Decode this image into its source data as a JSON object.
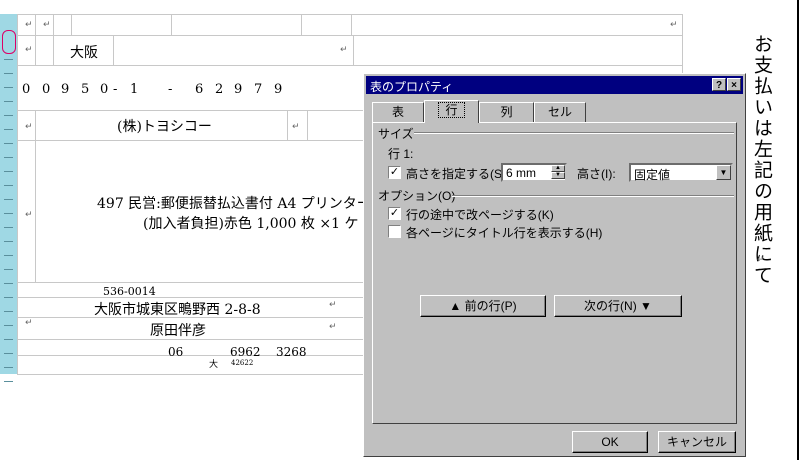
{
  "document": {
    "city_cell": "大阪",
    "zip_digits": [
      "0",
      "0",
      "9",
      "5",
      "0",
      "-",
      "1",
      "-",
      "6",
      "2",
      "9",
      "7",
      "9"
    ],
    "company": "(株)トヨシコー",
    "product_line1": "497 民営:郵便振替払込書付 A4 プリンター",
    "product_line2": "(加入者負担)赤色 1,000 枚 ×1 ケ",
    "postal_code": "536-0014",
    "address": "大阪市城東区鴫野西 2-8-8",
    "name": "原田伴彦",
    "phone_1": "06",
    "phone_2": "6962",
    "phone_3": "3268",
    "small_1": "大",
    "small_2": "42622",
    "vertical_text": "お支払いは左記の用紙にて",
    "para_mark": "↵"
  },
  "dialog": {
    "title": "表のプロパティ",
    "help_btn": "?",
    "close_btn": "×",
    "tabs": [
      {
        "label": "表"
      },
      {
        "label": "行"
      },
      {
        "label": "列"
      },
      {
        "label": "セル"
      }
    ],
    "size_group": "サイズ",
    "row_label": "行 1:",
    "height_check_label": "高さを指定する(S):",
    "height_value": "6 mm",
    "height_mode_label": "高さ(I):",
    "height_mode_value": "固定値",
    "options_group": "オプション(O)",
    "option1": "行の途中で改ページする(K)",
    "option2": "各ページにタイトル行を表示する(H)",
    "prev_row": "前の行(P)",
    "next_row": "次の行(N)",
    "ok": "OK",
    "cancel": "キャンセル"
  }
}
